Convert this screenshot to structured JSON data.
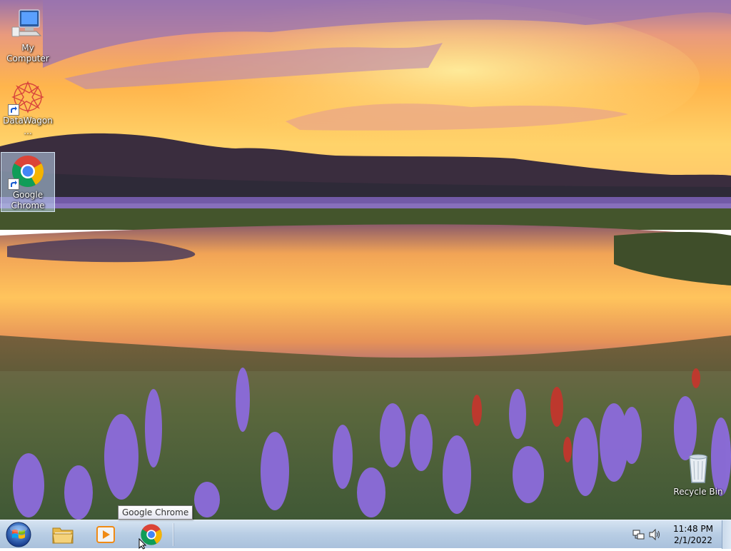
{
  "desktop": {
    "icons": [
      {
        "label": "My Computer",
        "icon": "computer-icon",
        "shortcut": false,
        "selected": false
      },
      {
        "label": "DataWagon...",
        "icon": "datawagon-icon",
        "shortcut": true,
        "selected": false
      },
      {
        "label": "Google Chrome",
        "icon": "chrome-icon",
        "shortcut": true,
        "selected": true
      },
      {
        "label": "Recycle Bin",
        "icon": "recycle-bin-icon",
        "shortcut": false,
        "selected": false
      }
    ]
  },
  "taskbar": {
    "start_button": "start-orb-icon",
    "pinned": [
      {
        "name": "Windows Explorer",
        "icon": "folder-icon"
      },
      {
        "name": "Windows Media Player",
        "icon": "media-player-icon"
      },
      {
        "name": "Google Chrome",
        "icon": "chrome-icon"
      }
    ],
    "tray": {
      "network_icon": "network-icon",
      "volume_icon": "volume-icon",
      "time": "11:48 PM",
      "date": "2/1/2022"
    }
  },
  "tooltip": {
    "text": "Google Chrome"
  },
  "colors": {
    "taskbar": "#b8cde4",
    "selection": "#bed7f0",
    "sky_top": "#9a6fa8",
    "sky_glow": "#ffc04a",
    "lupine": "#8a6ad8"
  }
}
